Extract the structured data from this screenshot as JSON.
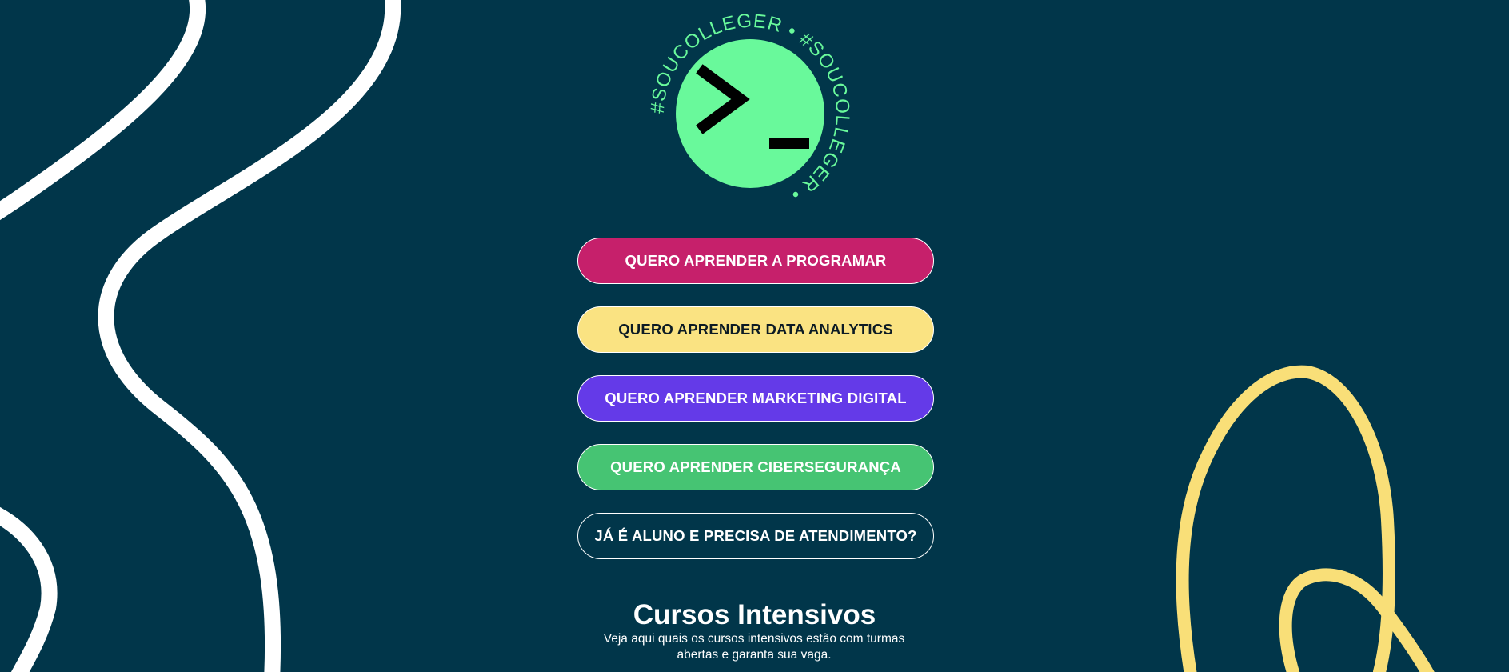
{
  "brand": {
    "logo_ring_text": "#SOUCOLLEGER",
    "logo_colors": {
      "circle": "#69f99b",
      "glyph": "#000000",
      "ring_text": "#69f99b"
    }
  },
  "buttons": [
    {
      "label": "QUERO APRENDER A PROGRAMAR",
      "bg": "#c6206b",
      "color": "#ffffff"
    },
    {
      "label": "QUERO APRENDER DATA ANALYTICS",
      "bg": "#fae382",
      "color": "#0c1b24"
    },
    {
      "label": "QUERO APRENDER MARKETING DIGITAL",
      "bg": "#643ae8",
      "color": "#ffffff"
    },
    {
      "label": "QUERO APRENDER CIBERSEGURANÇA",
      "bg": "#46c473",
      "color": "#ffffff"
    },
    {
      "label": "JÁ É ALUNO E PRECISA DE ATENDIMENTO?",
      "bg": "transparent",
      "color": "#ffffff"
    }
  ],
  "section": {
    "title": "Cursos Intensivos",
    "description": "Veja aqui quais os cursos intensivos estão com turmas abertas e garanta sua vaga."
  },
  "theme": {
    "background": "#01364a",
    "left_squiggle": "#ffffff",
    "right_squiggle": "#f9df78"
  }
}
